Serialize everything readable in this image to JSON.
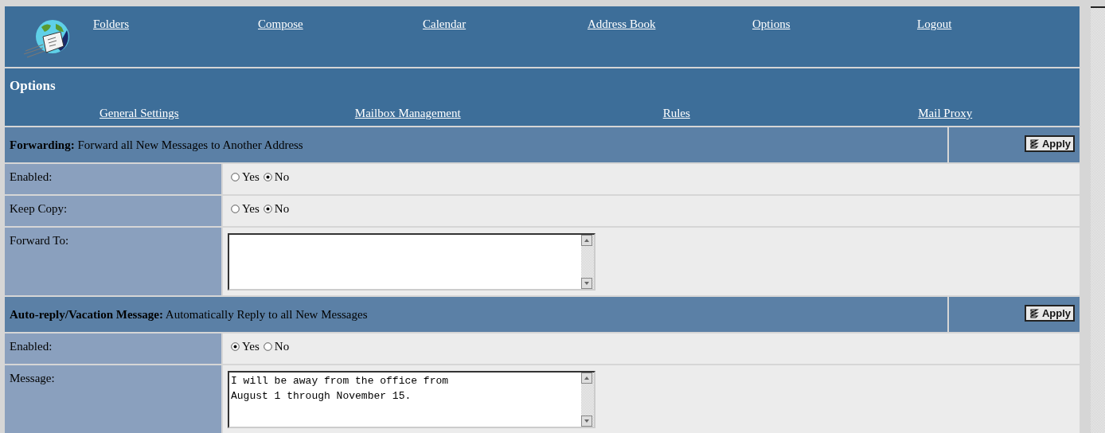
{
  "nav": [
    {
      "label": "Folders"
    },
    {
      "label": "Compose"
    },
    {
      "label": "Calendar"
    },
    {
      "label": "Address Book"
    },
    {
      "label": "Options"
    },
    {
      "label": "Logout"
    }
  ],
  "page_title": "Options",
  "subnav": [
    {
      "label": "General Settings"
    },
    {
      "label": "Mailbox Management"
    },
    {
      "label": "Rules"
    },
    {
      "label": "Mail Proxy"
    }
  ],
  "sections": [
    {
      "title": "Forwarding:",
      "description": "Forward all New Messages to Another Address",
      "button": "Apply",
      "rows": [
        {
          "kind": "radio",
          "label": "Enabled:",
          "options": [
            {
              "label": "Yes",
              "selected": false
            },
            {
              "label": "No",
              "selected": true
            }
          ]
        },
        {
          "kind": "radio",
          "label": "Keep Copy:",
          "options": [
            {
              "label": "Yes",
              "selected": false
            },
            {
              "label": "No",
              "selected": true
            }
          ]
        },
        {
          "kind": "textarea",
          "label": "Forward To:"
        }
      ]
    },
    {
      "title": "Auto-reply/Vacation Message:",
      "description": "Automatically Reply to all New Messages",
      "button": "Apply",
      "rows": [
        {
          "kind": "radio",
          "label": "Enabled:",
          "options": [
            {
              "label": "Yes",
              "selected": true
            },
            {
              "label": "No",
              "selected": false
            }
          ]
        },
        {
          "kind": "textarea",
          "label": "Message:",
          "value": "I will be away from the office from\nAugust 1 through November 15."
        }
      ]
    }
  ]
}
